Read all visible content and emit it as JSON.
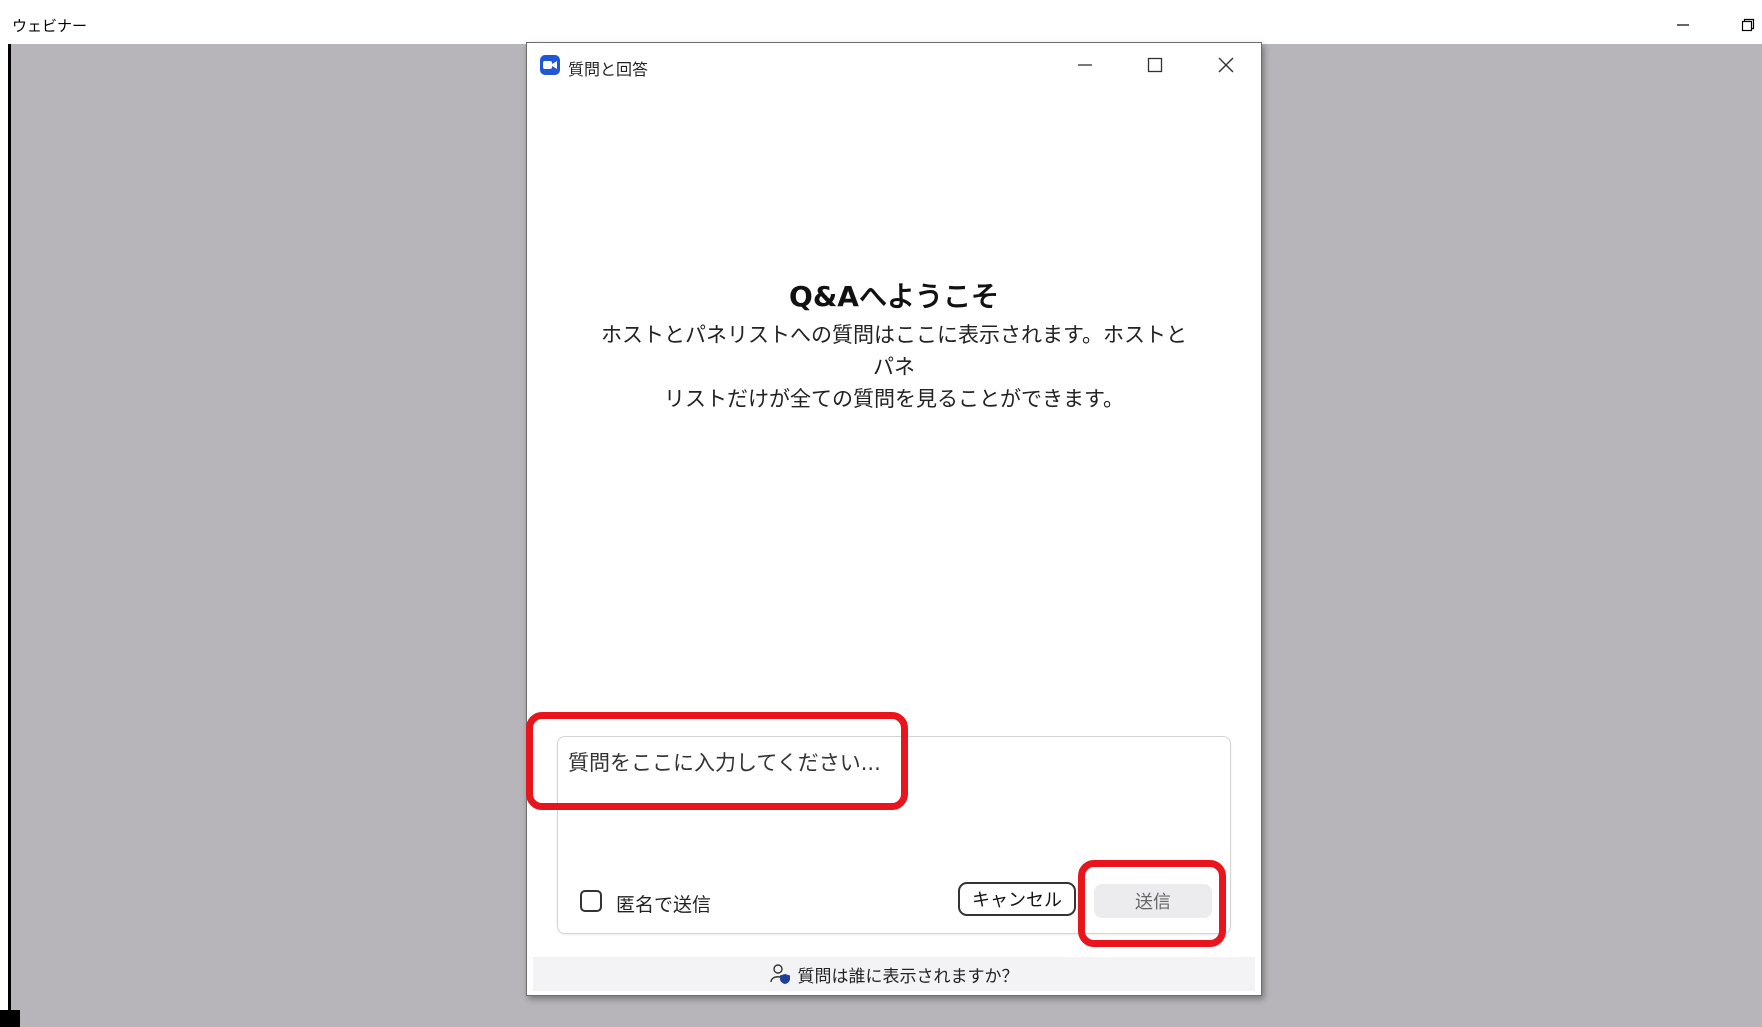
{
  "outer_window": {
    "title": "ウェビナー"
  },
  "dialog": {
    "title": "質問と回答",
    "welcome_title": "Q&Aへようこそ",
    "welcome_line1": "ホストとパネリストへの質問はここに表示されます。ホストとパネ",
    "welcome_line2": "リストだけが全ての質問を見ることができます。",
    "input": {
      "placeholder": "質問をここに入力してください..."
    },
    "anonymous_label": "匿名で送信",
    "anonymous_checked": false,
    "cancel_label": "キャンセル",
    "send_label": "送信",
    "footer_text": "質問は誰に表示されますか？"
  },
  "colors": {
    "highlight": "#e8161c",
    "app_icon": "#1f57d6",
    "background": "#b7b5b9"
  }
}
